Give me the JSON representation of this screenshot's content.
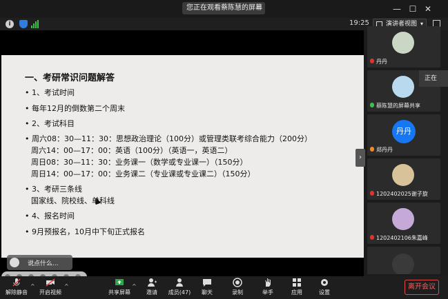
{
  "titlebar": {
    "share_banner": "您正在观看蔡陈慧的屏幕",
    "menu_icon": "≡",
    "minimize": "—",
    "maximize": "☐",
    "close": "✕"
  },
  "infobar": {
    "info_glyph": "i",
    "timer": "19:25",
    "view_label": "演讲者视图",
    "view_caret": "▾"
  },
  "slide": {
    "title": "一、考研常识问题解答",
    "lines": [
      "• 1、考试时间",
      "• 每年12月的倒数第二个周末",
      "• 2、考试科目",
      "• 周六08：30—11：30：思想政治理论（100分）或管理类联考综合能力（200分）",
      "周六14：00—17：00：英语（100分）（英语一，英语二）",
      "周日08：30—11：30：业务课一（数学或专业课一）（150分）",
      "周日14：00—17：00：业务课二（专业课或专业课二）（150分）",
      "• 3、考研三条线",
      "国家线、院校线、单科线",
      "• 4、报名时间",
      "• 9月预报名，10月中下旬正式报名"
    ]
  },
  "chat_hint": "说点什么...",
  "collapse_glyph": "›",
  "participants": [
    {
      "name": "丹丹"
    },
    {
      "name": "蔡陈慧的屏幕共享"
    },
    {
      "name": "郑丹丹",
      "avatar_text": "丹丹"
    },
    {
      "name": "1202402025谢子旋"
    },
    {
      "name": "1202402106朱嘉峰"
    }
  ],
  "popout_text": "正在",
  "toolbar": {
    "mute": "解除静音",
    "video": "开启视频",
    "share": "共享屏幕",
    "invite": "邀请",
    "participants": "成员(47)",
    "chat": "聊天",
    "record": "录制",
    "raise_hand": "举手",
    "apps": "应用",
    "settings": "设置",
    "leave": "离开会议",
    "caret": "^"
  },
  "colors": {
    "accent_blue": "#1777f2",
    "leave_red": "#e04a4a",
    "share_green": "#3cc24a"
  }
}
